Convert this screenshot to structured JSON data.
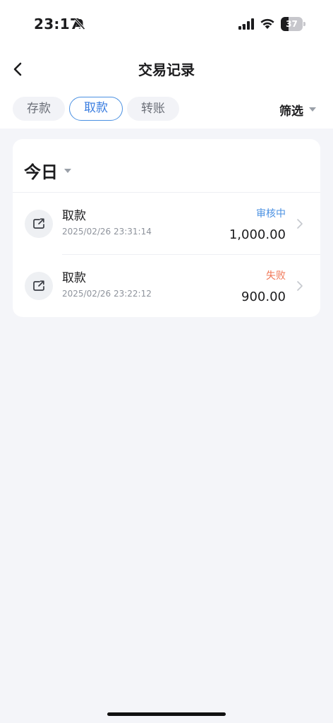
{
  "status_bar": {
    "time": "23:17",
    "battery_level": "37",
    "battery_fraction": 0.37
  },
  "nav": {
    "title": "交易记录",
    "back_icon": "chevron-left-icon"
  },
  "tabs": [
    {
      "label": "存款",
      "active": false
    },
    {
      "label": "取款",
      "active": true
    },
    {
      "label": "转账",
      "active": false
    }
  ],
  "filter": {
    "label": "筛选"
  },
  "section": {
    "title": "今日"
  },
  "transactions": [
    {
      "type": "取款",
      "date": "2025/02/26 23:31:14",
      "status": "审核中",
      "status_color": "#4a90e2",
      "amount": "1,000.00",
      "icon": "withdraw-icon"
    },
    {
      "type": "取款",
      "date": "2025/02/26 23:22:12",
      "status": "失败",
      "status_color": "#f07656",
      "amount": "900.00",
      "icon": "withdraw-icon"
    }
  ],
  "colors": {
    "accent": "#4a90e2",
    "failed": "#f07656",
    "background": "#f4f5f9"
  }
}
